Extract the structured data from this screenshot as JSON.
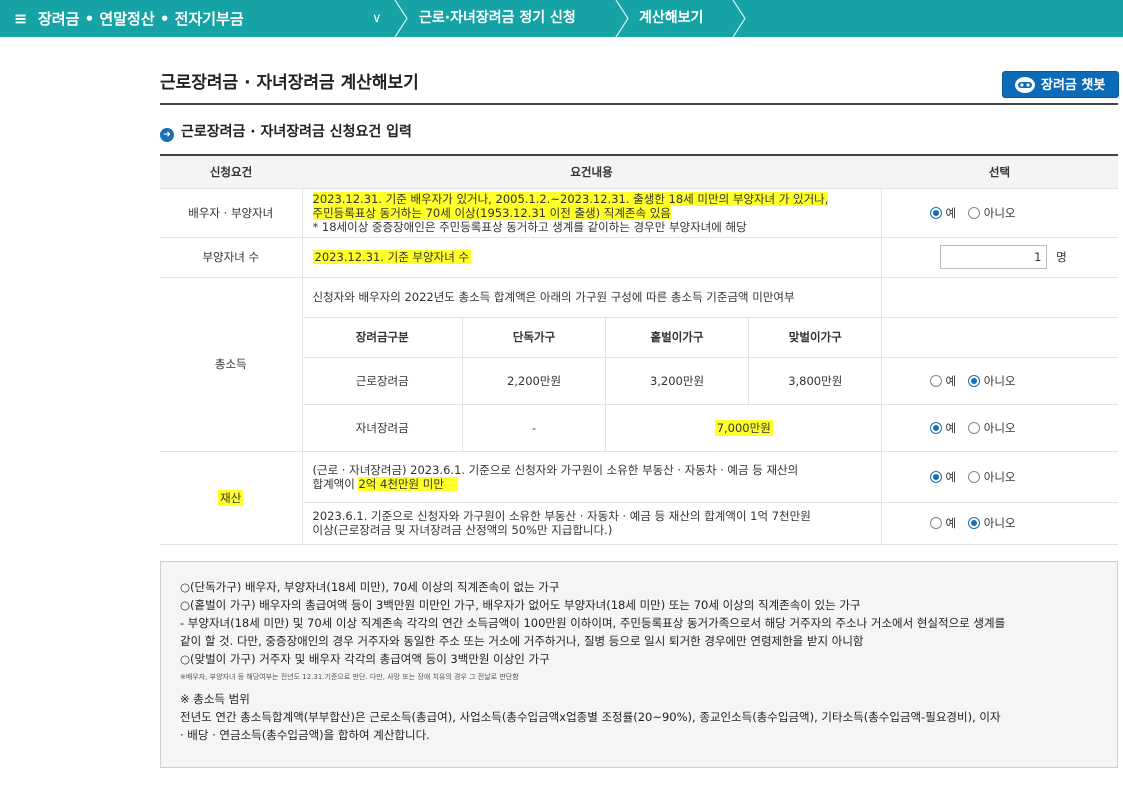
{
  "nav": {
    "menu_label": "장려금 • 연말정산 • 전자기부금",
    "breadcrumb": [
      "근로·자녀장려금 정기 신청",
      "계산해보기"
    ]
  },
  "page": {
    "title": "근로장려금 · 자녀장려금 계산해보기",
    "chatbot_label": "장려금 챗봇",
    "section_title": "근로장려금 · 자녀장려금 신청요건 입력"
  },
  "table": {
    "headers": [
      "신청요건",
      "요건내용",
      "선택"
    ],
    "spouse": {
      "label": "배우자 · 부양자녀",
      "line1": "2023.12.31. 기준 배우자가 있거나, 2005.1.2.~2023.12.31. 출생한 18세 미만의 부양자녀 가 있거나,",
      "line2": "주민등록표상 동거하는 70세 이상(1953.12.31 이전 출생) 직계존속 있음",
      "line3": "* 18세이상 중증장애인은 주민등록표상 동거하고 생계를 같이하는 경우만 부양자녀에 해당"
    },
    "dependents": {
      "label": "부양자녀 수",
      "text": "2023.12.31. 기준 부양자녀 수",
      "value": "1",
      "unit": "명"
    },
    "income": {
      "label": "총소득",
      "intro": "신청자와 배우자의 2022년도 총소득 합계액은 아래의 가구원 구성에 따른 총소득 기준금액 미만여부",
      "sub_headers": [
        "장려금구분",
        "단독가구",
        "홑벌이가구",
        "맞벌이가구"
      ],
      "rows": [
        {
          "name": "근로장려금",
          "values": [
            "2,200만원",
            "3,200만원",
            "3,800만원"
          ]
        },
        {
          "name": "자녀장려금",
          "single": "-",
          "merged": "7,000만원"
        }
      ]
    },
    "asset": {
      "label": "재산",
      "text1a": "(근로 · 자녀장려금) 2023.6.1. 기준으로 신청자와 가구원이 소유한 부동산 · 자동차 · 예금 등 재산의",
      "text1b_prefix": "합계액이 ",
      "text1b_hl": "2억 4천만원 미만",
      "text2a": "2023.6.1. 기준으로 신청자와 가구원이 소유한 부동산 · 자동차 · 예금 등 재산의 합계액이 1억 7천만원",
      "text2b": "이상(근로장려금 및 자녀장려금 산정액의 50%만 지급합니다.)"
    },
    "radio": {
      "yes": "예",
      "no": "아니오"
    }
  },
  "notes": {
    "lines": [
      "○(단독가구) 배우자, 부양자녀(18세 미만), 70세 이상의 직계존속이 없는 가구",
      "○(홑벌이 가구) 배우자의 총급여액 등이 3백만원 미만인 가구, 배우자가 없어도 부양자녀(18세 미만) 또는 70세 이상의 직계존속이 있는 가구",
      "- 부양자녀(18세 미만) 및 70세 이상 직계존속 각각의 연간 소득금액이 100만원 이하이며, 주민등록표상 동거가족으로서 해당 거주자의 주소나 거소에서 현실적으로 생계를",
      "같이 할 것. 다만, 중증장애인의 경우 거주자와 동일한 주소 또는 거소에 거주하거나, 질병 등으로 일시 퇴거한 경우에만 연령제한을 받지 아니함",
      "○(맞벌이 가구) 거주자 및 배우자 각각의 총급여액 등이 3백만원 이상인 가구"
    ],
    "tiny": "※배우자, 부양자녀 등 해당여부는 전년도 12.31.기준으로 판단. 다만, 사망 또는 장애 치유의 경우 그 전날로 판단함",
    "range_title": "※ 총소득 범위",
    "range_line1": "전년도 연간 총소득합계액(부부합산)은 근로소득(총급여), 사업소득(총수입금액x업종별 조정률(20~90%), 종교인소득(총수입금액), 기타소득(총수입금액-필요경비), 이자",
    "range_line2": "· 배당 · 연금소득(총수입금액)을 합하여 계산합니다."
  }
}
